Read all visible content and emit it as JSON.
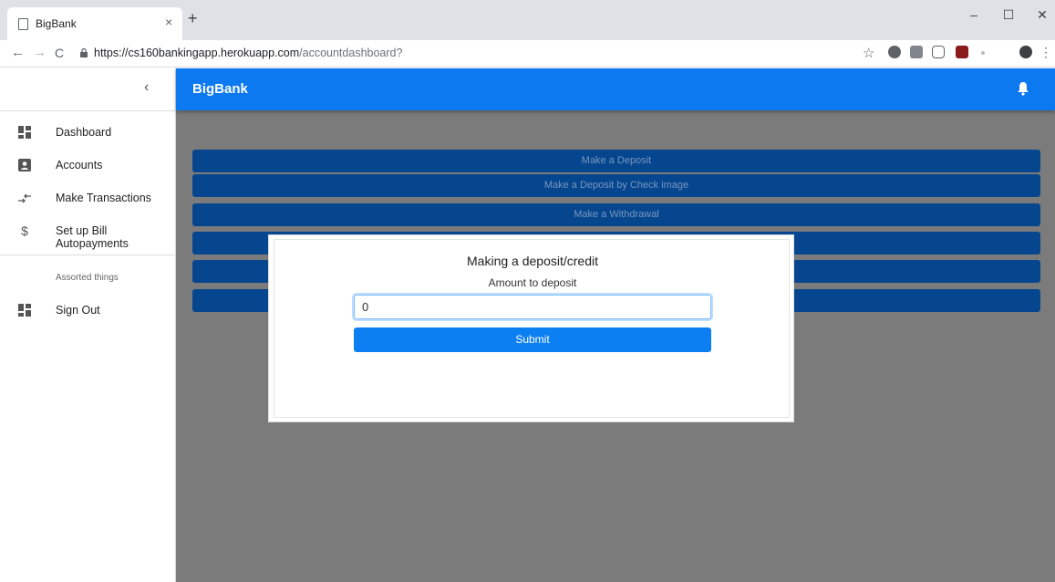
{
  "browser": {
    "tab_title": "BigBank",
    "tab_close": "×",
    "new_tab": "+",
    "url_host": "https://cs160bankingapp.herokuapp.com",
    "url_path": "/accountdashboard?",
    "back": "←",
    "forward": "→",
    "reload": "C",
    "star": "☆",
    "menu": "⋮",
    "minimize": "–",
    "maximize": "☐",
    "close": "✕"
  },
  "sidebar": {
    "collapse": "‹",
    "items": [
      {
        "label": "Dashboard",
        "icon": "dashboard-icon"
      },
      {
        "label": "Accounts",
        "icon": "account-box-icon"
      },
      {
        "label": "Make Transactions",
        "icon": "swap-arrows-icon"
      },
      {
        "label": "Set up Bill Autopayments",
        "icon": "dollar-icon"
      }
    ],
    "section_title": "Assorted things",
    "signout": {
      "label": "Sign Out",
      "icon": "dashboard-icon"
    }
  },
  "header": {
    "brand": "BigBank"
  },
  "actions": [
    "Make a Deposit",
    "Make a Deposit by Check image",
    "Make a Withdrawal",
    "",
    "",
    ""
  ],
  "modal": {
    "title": "Making a deposit/credit",
    "subtitle": "Amount to deposit",
    "amount_value": "0",
    "submit_label": "Submit"
  },
  "colors": {
    "primary": "#0d79f0",
    "action_button": "#05468f",
    "overlay": "#7b7b7b"
  }
}
